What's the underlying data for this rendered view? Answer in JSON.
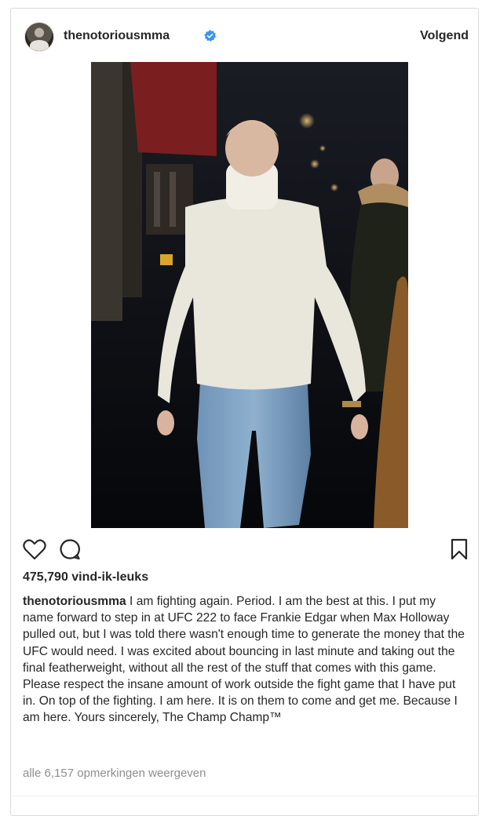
{
  "post": {
    "username": "thenotoriousmma",
    "follow_label": "Volgend",
    "likes_text": "475,790 vind-ik-leuks",
    "caption_user": "thenotoriousmma",
    "caption_text": "I am fighting again. Period. I am the best at this. I put my name forward to step in at UFC 222 to face Frankie Edgar when Max Holloway pulled out, but I was told there wasn't enough time to generate the money that the UFC would need. I was excited about bouncing in last minute and taking out the final featherweight, without all the rest of the stuff that comes with this game. Please respect the insane amount of work outside the fight game that I have put in. On top of the fighting. I am here. It is on them to come and get me. Because I am here. Yours sincerely, The Champ Champ™",
    "view_comments": "alle 6,157 opmerkingen weergeven"
  },
  "icons": {
    "verified": "verified-badge-icon",
    "like": "heart-icon",
    "comment": "comment-icon",
    "save": "bookmark-icon"
  },
  "colors": {
    "verified": "#3897f0",
    "text": "#262626",
    "muted": "#8e8e8e",
    "border": "#dbdbdb"
  }
}
